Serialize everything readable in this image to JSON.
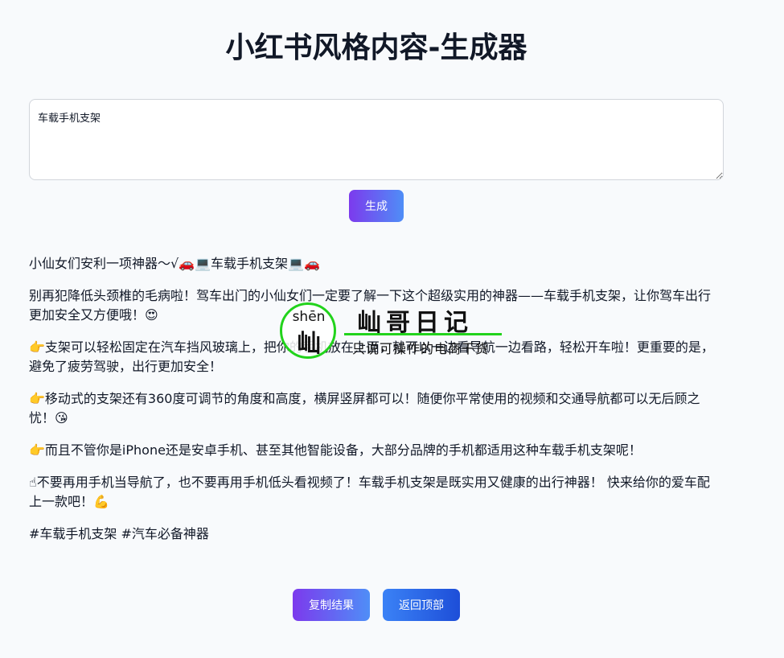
{
  "page": {
    "title": "小红书风格内容-生成器"
  },
  "input": {
    "value": "车载手机支架"
  },
  "buttons": {
    "generate_label": "生成",
    "copy_label": "复制结果",
    "back_to_top_label": "返回顶部"
  },
  "result": {
    "paragraphs": [
      "小仙女们安利一项神器～√🚗💻车载手机支架💻🚗",
      "别再犯降低头颈椎的毛病啦！驾车出门的小仙女们一定要了解一下这个超级实用的神器——车载手机支架，让你驾车出行更加安全又方便哦！😍",
      "👉支架可以轻松固定在汽车挡风玻璃上，把你的手机放在上面，就可以一边看导航一边看路，轻松开车啦！更重要的是，避免了疲劳驾驶，出行更加安全！",
      "👉移动式的支架还有360度可调节的角度和高度，横屏竖屏都可以！随便你平常使用的视频和交通导航都可以无后顾之忧！😘",
      "👉而且不管你是iPhone还是安卓手机、甚至其他智能设备，大部分品牌的手机都适用这种车载手机支架呢！",
      "☝不要再用手机当导航了，也不要再用手机低头看视频了！车载手机支架是既实用又健康的出行神器！ 快来给你的爱车配上一款吧！💪",
      "#车载手机支架 #汽车必备神器"
    ]
  },
  "watermark": {
    "pinyin": "shēn",
    "char": "屾",
    "name": "屾哥日记",
    "slogan": "只说可操作的电商干货"
  },
  "colors": {
    "accent_purple": "#7c3aed",
    "accent_blue": "#3b82f6",
    "watermark_green": "#22d31c"
  }
}
